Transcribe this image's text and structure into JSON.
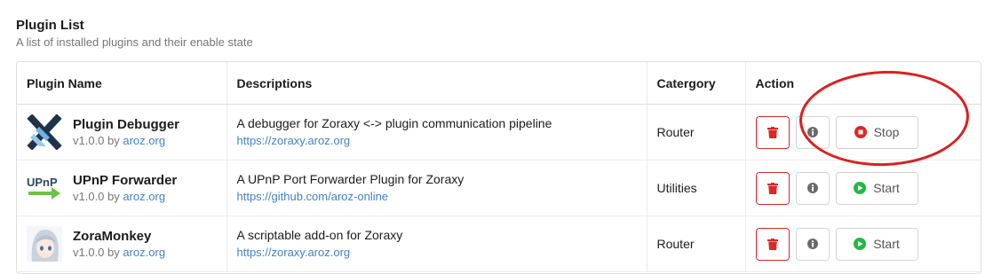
{
  "header": {
    "title": "Plugin List",
    "subtitle": "A list of installed plugins and their enable state"
  },
  "table": {
    "columns": [
      "Plugin Name",
      "Descriptions",
      "Catergory",
      "Action"
    ],
    "rows": [
      {
        "icon": "x-debugger-icon",
        "name": "Plugin Debugger",
        "version": "v1.0.0 by ",
        "author": "aroz.org",
        "description": "A debugger for Zoraxy <-> plugin communication pipeline",
        "link": "https://zoraxy.aroz.org",
        "category": "Router",
        "toggle_label": "Stop",
        "toggle_state": "running"
      },
      {
        "icon": "upnp-arrow-icon",
        "icon_text": "UPnP",
        "name": "UPnP Forwarder",
        "version": "v1.0.0 by ",
        "author": "aroz.org",
        "description": "A UPnP Port Forwarder Plugin for Zoraxy",
        "link": "https://github.com/aroz-online",
        "category": "Utilities",
        "toggle_label": "Start",
        "toggle_state": "stopped"
      },
      {
        "icon": "anime-avatar-icon",
        "name": "ZoraMonkey",
        "version": "v1.0.0 by ",
        "author": "aroz.org",
        "description": "A scriptable add-on for Zoraxy",
        "link": "https://zoraxy.aroz.org",
        "category": "Router",
        "toggle_label": "Start",
        "toggle_state": "stopped"
      }
    ]
  },
  "colors": {
    "delete": "#db2828",
    "stop": "#db2828",
    "start": "#21ba45",
    "link": "#4183c4",
    "annotation": "#dc1f1f"
  }
}
